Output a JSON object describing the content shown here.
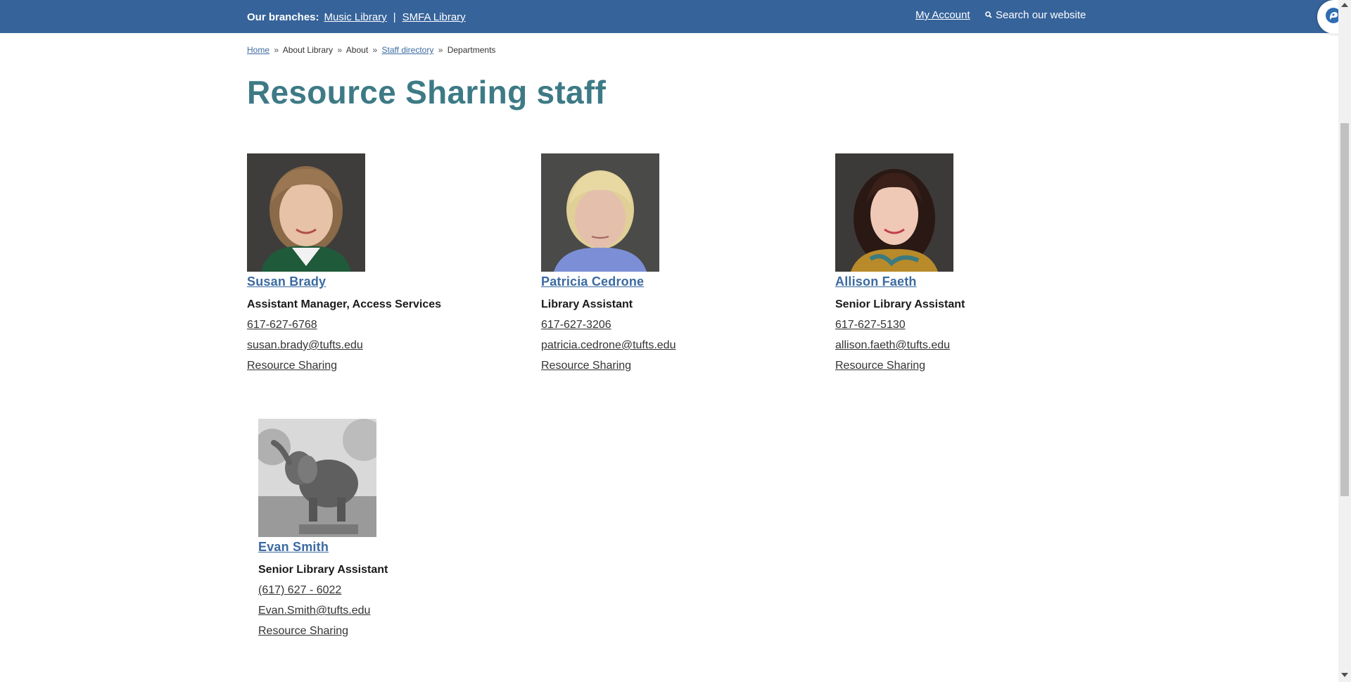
{
  "topbar": {
    "branches_label": "Our branches:",
    "branches": [
      "Music Library",
      "SMFA Library"
    ],
    "separator": "|",
    "my_account": "My Account",
    "search": "Search our website"
  },
  "breadcrumb": {
    "home": "Home",
    "about_library": "About Library",
    "about": "About",
    "staff_directory": "Staff directory",
    "departments": "Departments",
    "sep": "»"
  },
  "page_title": "Resource Sharing staff",
  "staff": [
    {
      "name": "Susan Brady",
      "title": "Assistant Manager, Access Services",
      "phone": "617-627-6768",
      "email": "susan.brady@tufts.edu",
      "department": "Resource Sharing"
    },
    {
      "name": "Patricia Cedrone",
      "title": "Library Assistant",
      "phone": "617-627-3206",
      "email": "patricia.cedrone@tufts.edu",
      "department": "Resource Sharing"
    },
    {
      "name": "Allison Faeth",
      "title": "Senior Library Assistant",
      "phone": "617-627-5130",
      "email": "allison.faeth@tufts.edu",
      "department": "Resource Sharing"
    },
    {
      "name": "Evan Smith",
      "title": "Senior Library Assistant",
      "phone": "(617) 627 - 6022",
      "email": "Evan.Smith@tufts.edu",
      "department": "Resource Sharing"
    }
  ],
  "colors": {
    "topbar": "#36639a",
    "title": "#3d7a85",
    "link": "#3b6aa0"
  },
  "icons": {
    "search": "search-icon",
    "chat": "chat-icon"
  }
}
